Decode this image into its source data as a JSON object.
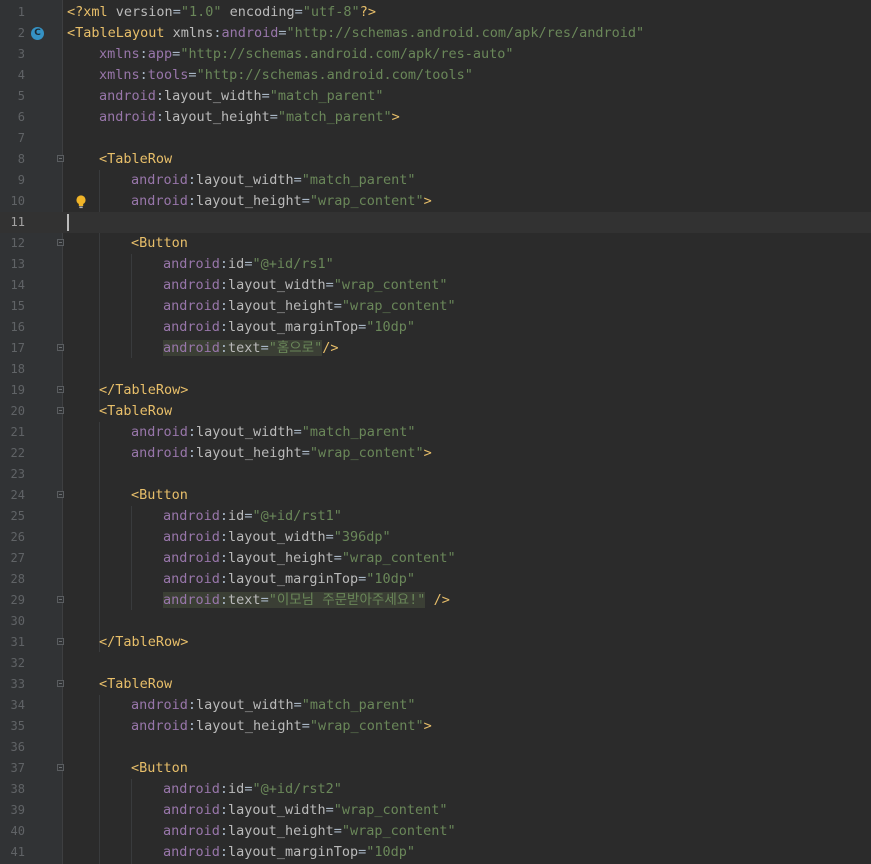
{
  "editor": {
    "current_line": 11,
    "caret_line": 11,
    "gutter_marker_line": 2,
    "gutter_marker_icon": "class-c-icon",
    "gutter_marker_glyph": "C",
    "intention_bulb_line": 10,
    "intention_bulb_icon": "lightbulb-icon",
    "fold_lines": [
      8,
      12,
      17,
      19,
      20,
      24,
      29,
      31,
      33,
      37
    ],
    "colors": {
      "background": "#2b2b2b",
      "gutter": "#313335",
      "line_number": "#606366",
      "tag": "#e8bf6a",
      "attribute": "#bababa",
      "namespace": "#9876aa",
      "value": "#6a8759",
      "text": "#a9b7c6",
      "highlight": "#3b3f35",
      "marker": "#3592c4",
      "bulb": "#f0b428"
    },
    "lines": [
      {
        "n": "1",
        "indent": 0,
        "tokens": [
          [
            "tag",
            "<?xml "
          ],
          [
            "attr",
            "version"
          ],
          [
            "text",
            "="
          ],
          [
            "val",
            "\"1.0\""
          ],
          [
            "text",
            " "
          ],
          [
            "attr",
            "encoding"
          ],
          [
            "text",
            "="
          ],
          [
            "val",
            "\"utf-8\""
          ],
          [
            "tag",
            "?>"
          ]
        ]
      },
      {
        "n": "2",
        "indent": 0,
        "tokens": [
          [
            "tag",
            "<TableLayout "
          ],
          [
            "attr",
            "xmlns"
          ],
          [
            "text",
            ":"
          ],
          [
            "ns",
            "android"
          ],
          [
            "text",
            "="
          ],
          [
            "val",
            "\"http://schemas.android.com/apk/res/android\""
          ]
        ]
      },
      {
        "n": "3",
        "indent": 1,
        "tokens": [
          [
            "ns",
            "xmlns"
          ],
          [
            "text",
            ":"
          ],
          [
            "ns",
            "app"
          ],
          [
            "text",
            "="
          ],
          [
            "val",
            "\"http://schemas.android.com/apk/res-auto\""
          ]
        ]
      },
      {
        "n": "4",
        "indent": 1,
        "tokens": [
          [
            "ns",
            "xmlns"
          ],
          [
            "text",
            ":"
          ],
          [
            "ns",
            "tools"
          ],
          [
            "text",
            "="
          ],
          [
            "val",
            "\"http://schemas.android.com/tools\""
          ]
        ]
      },
      {
        "n": "5",
        "indent": 1,
        "tokens": [
          [
            "ns",
            "android"
          ],
          [
            "text",
            ":"
          ],
          [
            "attr",
            "layout_width"
          ],
          [
            "text",
            "="
          ],
          [
            "val",
            "\"match_parent\""
          ]
        ]
      },
      {
        "n": "6",
        "indent": 1,
        "tokens": [
          [
            "ns",
            "android"
          ],
          [
            "text",
            ":"
          ],
          [
            "attr",
            "layout_height"
          ],
          [
            "text",
            "="
          ],
          [
            "val",
            "\"match_parent\""
          ],
          [
            "tag",
            ">"
          ]
        ]
      },
      {
        "n": "7",
        "indent": 0,
        "tokens": []
      },
      {
        "n": "8",
        "indent": 1,
        "tokens": [
          [
            "tag",
            "<TableRow"
          ]
        ]
      },
      {
        "n": "9",
        "indent": 2,
        "tokens": [
          [
            "ns",
            "android"
          ],
          [
            "text",
            ":"
          ],
          [
            "attr",
            "layout_width"
          ],
          [
            "text",
            "="
          ],
          [
            "val",
            "\"match_parent\""
          ]
        ]
      },
      {
        "n": "10",
        "indent": 2,
        "tokens": [
          [
            "ns",
            "android"
          ],
          [
            "text",
            ":"
          ],
          [
            "attr",
            "layout_height"
          ],
          [
            "text",
            "="
          ],
          [
            "val",
            "\"wrap_content\""
          ],
          [
            "tag",
            ">"
          ]
        ]
      },
      {
        "n": "11",
        "indent": 0,
        "tokens": []
      },
      {
        "n": "12",
        "indent": 2,
        "tokens": [
          [
            "tag",
            "<Button"
          ]
        ]
      },
      {
        "n": "13",
        "indent": 3,
        "tokens": [
          [
            "ns",
            "android"
          ],
          [
            "text",
            ":"
          ],
          [
            "attr",
            "id"
          ],
          [
            "text",
            "="
          ],
          [
            "val",
            "\"@+id/rs1\""
          ]
        ]
      },
      {
        "n": "14",
        "indent": 3,
        "tokens": [
          [
            "ns",
            "android"
          ],
          [
            "text",
            ":"
          ],
          [
            "attr",
            "layout_width"
          ],
          [
            "text",
            "="
          ],
          [
            "val",
            "\"wrap_content\""
          ]
        ]
      },
      {
        "n": "15",
        "indent": 3,
        "tokens": [
          [
            "ns",
            "android"
          ],
          [
            "text",
            ":"
          ],
          [
            "attr",
            "layout_height"
          ],
          [
            "text",
            "="
          ],
          [
            "val",
            "\"wrap_content\""
          ]
        ]
      },
      {
        "n": "16",
        "indent": 3,
        "tokens": [
          [
            "ns",
            "android"
          ],
          [
            "text",
            ":"
          ],
          [
            "attr",
            "layout_marginTop"
          ],
          [
            "text",
            "="
          ],
          [
            "val",
            "\"10dp\""
          ]
        ]
      },
      {
        "n": "17",
        "indent": 3,
        "tokens": [
          [
            "ns hl",
            "android"
          ],
          [
            "text hl",
            ":"
          ],
          [
            "attr hl",
            "text"
          ],
          [
            "text hl",
            "="
          ],
          [
            "val hl",
            "\"홈으로\""
          ],
          [
            "tag",
            "/>"
          ]
        ]
      },
      {
        "n": "18",
        "indent": 0,
        "tokens": []
      },
      {
        "n": "19",
        "indent": 1,
        "tokens": [
          [
            "tag",
            "</TableRow>"
          ]
        ]
      },
      {
        "n": "20",
        "indent": 1,
        "tokens": [
          [
            "tag",
            "<TableRow"
          ]
        ]
      },
      {
        "n": "21",
        "indent": 2,
        "tokens": [
          [
            "ns",
            "android"
          ],
          [
            "text",
            ":"
          ],
          [
            "attr",
            "layout_width"
          ],
          [
            "text",
            "="
          ],
          [
            "val",
            "\"match_parent\""
          ]
        ]
      },
      {
        "n": "22",
        "indent": 2,
        "tokens": [
          [
            "ns",
            "android"
          ],
          [
            "text",
            ":"
          ],
          [
            "attr",
            "layout_height"
          ],
          [
            "text",
            "="
          ],
          [
            "val",
            "\"wrap_content\""
          ],
          [
            "tag",
            ">"
          ]
        ]
      },
      {
        "n": "23",
        "indent": 0,
        "tokens": []
      },
      {
        "n": "24",
        "indent": 2,
        "tokens": [
          [
            "tag",
            "<Button"
          ]
        ]
      },
      {
        "n": "25",
        "indent": 3,
        "tokens": [
          [
            "ns",
            "android"
          ],
          [
            "text",
            ":"
          ],
          [
            "attr",
            "id"
          ],
          [
            "text",
            "="
          ],
          [
            "val",
            "\"@+id/rst1\""
          ]
        ]
      },
      {
        "n": "26",
        "indent": 3,
        "tokens": [
          [
            "ns",
            "android"
          ],
          [
            "text",
            ":"
          ],
          [
            "attr",
            "layout_width"
          ],
          [
            "text",
            "="
          ],
          [
            "val",
            "\"396dp\""
          ]
        ]
      },
      {
        "n": "27",
        "indent": 3,
        "tokens": [
          [
            "ns",
            "android"
          ],
          [
            "text",
            ":"
          ],
          [
            "attr",
            "layout_height"
          ],
          [
            "text",
            "="
          ],
          [
            "val",
            "\"wrap_content\""
          ]
        ]
      },
      {
        "n": "28",
        "indent": 3,
        "tokens": [
          [
            "ns",
            "android"
          ],
          [
            "text",
            ":"
          ],
          [
            "attr",
            "layout_marginTop"
          ],
          [
            "text",
            "="
          ],
          [
            "val",
            "\"10dp\""
          ]
        ]
      },
      {
        "n": "29",
        "indent": 3,
        "tokens": [
          [
            "ns hl",
            "android"
          ],
          [
            "text hl",
            ":"
          ],
          [
            "attr hl",
            "text"
          ],
          [
            "text hl",
            "="
          ],
          [
            "val hl",
            "\"이모님 주문받아주세요!\""
          ],
          [
            "text",
            " "
          ],
          [
            "tag",
            "/>"
          ]
        ]
      },
      {
        "n": "30",
        "indent": 0,
        "tokens": []
      },
      {
        "n": "31",
        "indent": 1,
        "tokens": [
          [
            "tag",
            "</TableRow>"
          ]
        ]
      },
      {
        "n": "32",
        "indent": 0,
        "tokens": []
      },
      {
        "n": "33",
        "indent": 1,
        "tokens": [
          [
            "tag",
            "<TableRow"
          ]
        ]
      },
      {
        "n": "34",
        "indent": 2,
        "tokens": [
          [
            "ns",
            "android"
          ],
          [
            "text",
            ":"
          ],
          [
            "attr",
            "layout_width"
          ],
          [
            "text",
            "="
          ],
          [
            "val",
            "\"match_parent\""
          ]
        ]
      },
      {
        "n": "35",
        "indent": 2,
        "tokens": [
          [
            "ns",
            "android"
          ],
          [
            "text",
            ":"
          ],
          [
            "attr",
            "layout_height"
          ],
          [
            "text",
            "="
          ],
          [
            "val",
            "\"wrap_content\""
          ],
          [
            "tag",
            ">"
          ]
        ]
      },
      {
        "n": "36",
        "indent": 0,
        "tokens": []
      },
      {
        "n": "37",
        "indent": 2,
        "tokens": [
          [
            "tag",
            "<Button"
          ]
        ]
      },
      {
        "n": "38",
        "indent": 3,
        "tokens": [
          [
            "ns",
            "android"
          ],
          [
            "text",
            ":"
          ],
          [
            "attr",
            "id"
          ],
          [
            "text",
            "="
          ],
          [
            "val",
            "\"@+id/rst2\""
          ]
        ]
      },
      {
        "n": "39",
        "indent": 3,
        "tokens": [
          [
            "ns",
            "android"
          ],
          [
            "text",
            ":"
          ],
          [
            "attr",
            "layout_width"
          ],
          [
            "text",
            "="
          ],
          [
            "val",
            "\"wrap_content\""
          ]
        ]
      },
      {
        "n": "40",
        "indent": 3,
        "tokens": [
          [
            "ns",
            "android"
          ],
          [
            "text",
            ":"
          ],
          [
            "attr",
            "layout_height"
          ],
          [
            "text",
            "="
          ],
          [
            "val",
            "\"wrap_content\""
          ]
        ]
      },
      {
        "n": "41",
        "indent": 3,
        "tokens": [
          [
            "ns",
            "android"
          ],
          [
            "text",
            ":"
          ],
          [
            "attr",
            "layout_marginTop"
          ],
          [
            "text",
            "="
          ],
          [
            "val",
            "\"10dp\""
          ]
        ]
      }
    ]
  }
}
